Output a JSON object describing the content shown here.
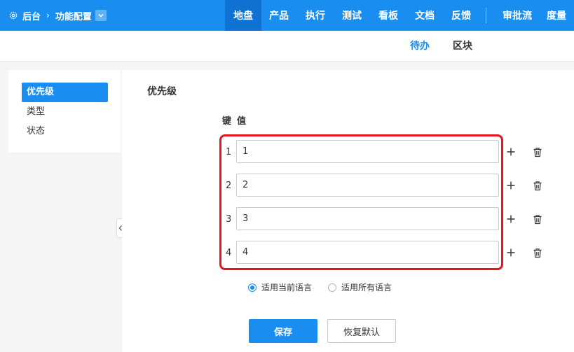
{
  "header": {
    "breadcrumb": {
      "root": "后台",
      "current": "功能配置"
    },
    "icons": {
      "settings": "gear-icon",
      "separator": "chevron-right-icon",
      "dropdown": "chevron-down-icon"
    },
    "nav": [
      {
        "label": "地盘",
        "active": true
      },
      {
        "label": "产品",
        "active": false
      },
      {
        "label": "执行",
        "active": false
      },
      {
        "label": "测试",
        "active": false
      },
      {
        "label": "看板",
        "active": false
      },
      {
        "label": "文档",
        "active": false
      },
      {
        "label": "反馈",
        "active": false
      },
      {
        "label": "审批流",
        "active": false
      },
      {
        "label": "度量",
        "active": false
      }
    ]
  },
  "subnav": {
    "tabs": [
      {
        "label": "待办",
        "active": true
      },
      {
        "label": "区块",
        "active": false
      }
    ]
  },
  "sidebar": {
    "items": [
      {
        "label": "优先级",
        "active": true
      },
      {
        "label": "类型",
        "active": false
      },
      {
        "label": "状态",
        "active": false
      }
    ],
    "collapse_icon": "chevron-left-icon"
  },
  "form": {
    "title": "优先级",
    "headers": {
      "key": "键",
      "value": "值"
    },
    "rows": [
      {
        "key": "1",
        "value": "1"
      },
      {
        "key": "2",
        "value": "2"
      },
      {
        "key": "3",
        "value": "3"
      },
      {
        "key": "4",
        "value": "4"
      }
    ],
    "row_icons": {
      "add": "plus-icon",
      "delete": "trash-icon"
    },
    "scope_options": [
      {
        "label": "适用当前语言",
        "checked": true
      },
      {
        "label": "适用所有语言",
        "checked": false
      }
    ],
    "buttons": {
      "save": "保存",
      "reset": "恢复默认"
    }
  },
  "colors": {
    "primary": "#1a8ef0",
    "nav_active": "#0f72d3",
    "highlight": "#e5141e"
  }
}
